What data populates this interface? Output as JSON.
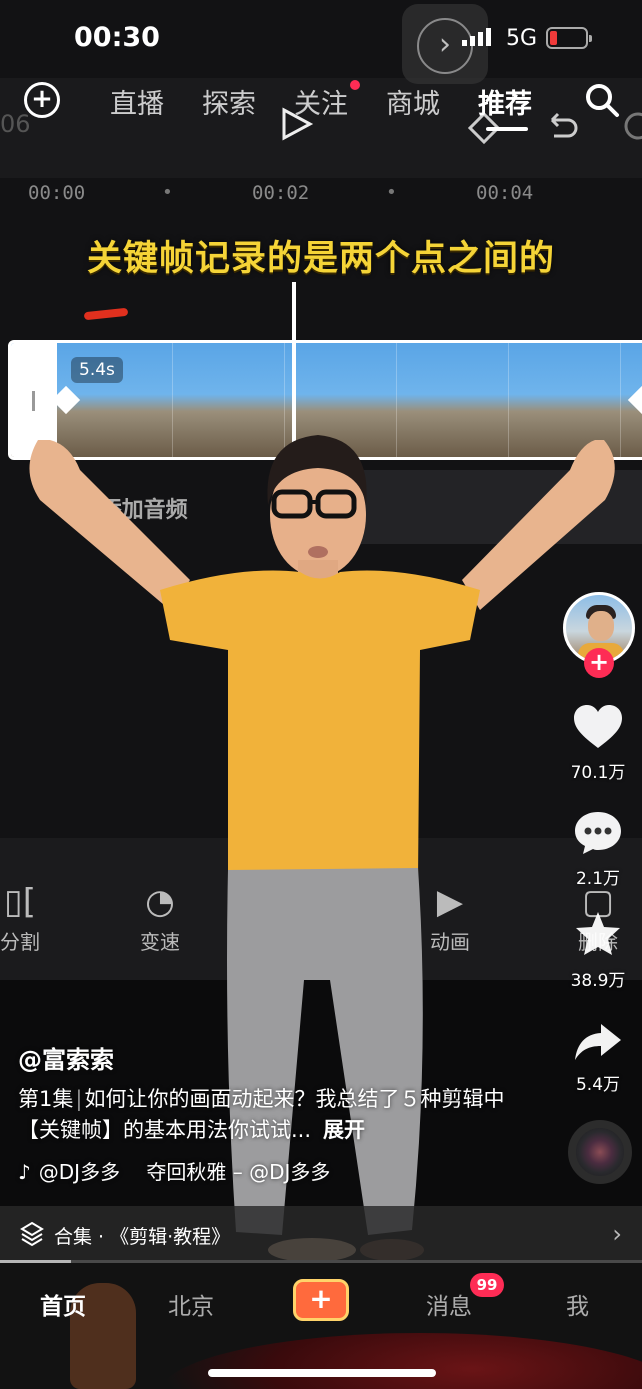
{
  "status_bar": {
    "time": "00:30",
    "network": "5G"
  },
  "top_nav": {
    "tabs": [
      {
        "label": "直播",
        "active": false
      },
      {
        "label": "探索",
        "active": false
      },
      {
        "label": "关注",
        "active": false,
        "has_dot": true
      },
      {
        "label": "商城",
        "active": false
      },
      {
        "label": "推荐",
        "active": true
      }
    ],
    "add_icon": "plus-circle-icon",
    "search_icon": "search-icon"
  },
  "video": {
    "ghost_number": "06",
    "timeline_ticks": [
      "00:00",
      "00:02",
      "00:04"
    ],
    "caption": "关键帧记录的是两个点之间的",
    "clip_duration": "5.4s",
    "add_audio_label": "添加音频",
    "tools": [
      {
        "label": "分割",
        "icon": "split-icon"
      },
      {
        "label": "变速",
        "icon": "speed-icon"
      },
      {
        "label": "动画",
        "icon": "animation-icon"
      },
      {
        "label": "删除",
        "icon": "delete-icon"
      }
    ]
  },
  "actions": {
    "like_count": "70.1万",
    "comment_count": "2.1万",
    "favorite_count": "38.9万",
    "share_count": "5.4万"
  },
  "post": {
    "author": "@富索索",
    "episode": "第1集",
    "description": "如何让你的画面动起来？我总结了５种剪辑中【关键帧】的基本用法你试试...",
    "more_label": "展开",
    "music": "@DJ多多　 夺回秋雅 – @DJ多多",
    "collection": "合集 · 《剪辑·教程》",
    "progress": 0.11
  },
  "bottom_tabs": {
    "home": "首页",
    "city": "北京",
    "create": "+",
    "messages": "消息",
    "messages_badge": "99",
    "me": "我"
  },
  "colors": {
    "accent": "#fe2c55",
    "caption": "#f5d437",
    "shirt": "#f1b23a"
  }
}
